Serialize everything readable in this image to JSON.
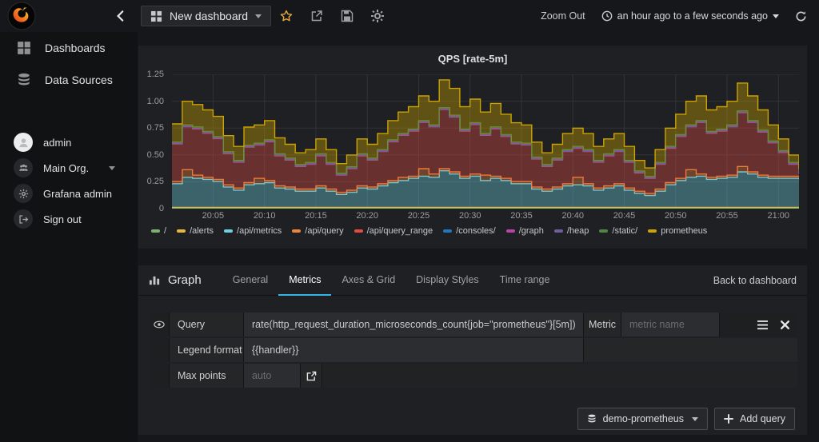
{
  "header": {
    "dashboard_title": "New dashboard",
    "zoom_out_label": "Zoom Out",
    "time_range_label": "an hour ago to a few seconds ago"
  },
  "sidebar": {
    "nav_items": [
      {
        "label": "Dashboards"
      },
      {
        "label": "Data Sources"
      }
    ],
    "account_items": [
      {
        "label": "admin"
      },
      {
        "label": "Main Org."
      },
      {
        "label": "Grafana admin"
      },
      {
        "label": "Sign out"
      }
    ]
  },
  "panel": {
    "title": "QPS [rate-5m]"
  },
  "chart_data": {
    "type": "area",
    "stacked": true,
    "steps": true,
    "title": "QPS [rate-5m]",
    "points": 62,
    "x_start": "20:01",
    "x_end": "21:02",
    "ylim": [
      0,
      1.25
    ],
    "y_ticks": [
      "0",
      "0.25",
      "0.50",
      "0.75",
      "1.00",
      "1.25"
    ],
    "x_ticks": [
      "20:05",
      "20:10",
      "20:15",
      "20:20",
      "20:25",
      "20:30",
      "20:35",
      "20:40",
      "20:45",
      "20:50",
      "20:55",
      "21:00"
    ],
    "tick_first_index": 4,
    "tick_step": 5,
    "grid": true,
    "legend_position": "bottom",
    "fill_opacity": 0.38,
    "series": [
      {
        "name": "/",
        "color": "#7EB26D",
        "value_constant": 0.004
      },
      {
        "name": "/alerts",
        "color": "#EAB839",
        "value_constant": 0.008
      },
      {
        "name": "/api/metrics",
        "color": "#6ED0E0",
        "values": [
          0.22,
          0.28,
          0.27,
          0.26,
          0.24,
          0.19,
          0.16,
          0.21,
          0.22,
          0.23,
          0.18,
          0.17,
          0.15,
          0.15,
          0.18,
          0.15,
          0.12,
          0.14,
          0.18,
          0.17,
          0.2,
          0.23,
          0.25,
          0.27,
          0.29,
          0.28,
          0.34,
          0.31,
          0.27,
          0.29,
          0.25,
          0.27,
          0.25,
          0.22,
          0.22,
          0.17,
          0.15,
          0.17,
          0.2,
          0.21,
          0.2,
          0.16,
          0.18,
          0.2,
          0.16,
          0.13,
          0.11,
          0.15,
          0.21,
          0.25,
          0.28,
          0.29,
          0.26,
          0.27,
          0.28,
          0.33,
          0.31,
          0.28,
          0.27,
          0.27,
          0.27,
          0.26
        ]
      },
      {
        "name": "/api/query",
        "color": "#EF843C",
        "values": [
          0.02,
          0.07,
          0.03,
          0.02,
          0.02,
          0.02,
          0.02,
          0.02,
          0.05,
          0.02,
          0.02,
          0.02,
          0.02,
          0.02,
          0.02,
          0.02,
          0.02,
          0.02,
          0.02,
          0.02,
          0.02,
          0.02,
          0.03,
          0.02,
          0.07,
          0.03,
          0.02,
          0.02,
          0.02,
          0.02,
          0.05,
          0.02,
          0.02,
          0.02,
          0.02,
          0.02,
          0.02,
          0.02,
          0.02,
          0.07,
          0.02,
          0.02,
          0.02,
          0.02,
          0.02,
          0.02,
          0.02,
          0.02,
          0.02,
          0.02,
          0.07,
          0.02,
          0.02,
          0.02,
          0.02,
          0.05,
          0.02,
          0.02,
          0.02,
          0.02,
          0.02,
          0.02
        ]
      },
      {
        "name": "/api/query_range",
        "color": "#E24D42",
        "values": [
          0.35,
          0.4,
          0.43,
          0.41,
          0.38,
          0.29,
          0.24,
          0.33,
          0.31,
          0.36,
          0.28,
          0.25,
          0.21,
          0.23,
          0.28,
          0.23,
          0.16,
          0.2,
          0.28,
          0.25,
          0.3,
          0.36,
          0.39,
          0.42,
          0.43,
          0.44,
          0.55,
          0.51,
          0.42,
          0.46,
          0.37,
          0.44,
          0.39,
          0.35,
          0.34,
          0.26,
          0.21,
          0.25,
          0.3,
          0.27,
          0.3,
          0.24,
          0.28,
          0.3,
          0.24,
          0.17,
          0.14,
          0.23,
          0.32,
          0.39,
          0.4,
          0.48,
          0.41,
          0.42,
          0.45,
          0.5,
          0.46,
          0.4,
          0.31,
          0.22,
          0.11,
          0.03
        ]
      },
      {
        "name": "/consoles/",
        "color": "#1F78C1",
        "value_constant": 0.004
      },
      {
        "name": "/graph",
        "color": "#BA43A9",
        "value_constant": 0.003
      },
      {
        "name": "/heap",
        "color": "#705DA0",
        "value_constant": 0.004
      },
      {
        "name": "/static/",
        "color": "#508642",
        "value_constant": 0.006
      },
      {
        "name": "prometheus",
        "color": "#CCA300",
        "values": [
          0.17,
          0.22,
          0.21,
          0.2,
          0.19,
          0.15,
          0.13,
          0.17,
          0.17,
          0.18,
          0.15,
          0.13,
          0.11,
          0.12,
          0.14,
          0.12,
          0.09,
          0.11,
          0.14,
          0.13,
          0.15,
          0.18,
          0.2,
          0.21,
          0.23,
          0.22,
          0.26,
          0.25,
          0.21,
          0.22,
          0.2,
          0.22,
          0.19,
          0.18,
          0.17,
          0.14,
          0.11,
          0.13,
          0.15,
          0.17,
          0.15,
          0.13,
          0.14,
          0.15,
          0.13,
          0.1,
          0.08,
          0.12,
          0.17,
          0.19,
          0.22,
          0.23,
          0.2,
          0.21,
          0.22,
          0.26,
          0.23,
          0.19,
          0.15,
          0.11,
          0.07,
          0.03
        ]
      }
    ]
  },
  "editor": {
    "panel_type_label": "Graph",
    "tabs": [
      {
        "label": "General"
      },
      {
        "label": "Metrics",
        "active": true
      },
      {
        "label": "Axes & Grid"
      },
      {
        "label": "Display Styles"
      },
      {
        "label": "Time range"
      }
    ],
    "back_to_dashboard_label": "Back to dashboard",
    "rows": {
      "query": {
        "label": "Query",
        "value": "rate(http_request_duration_microseconds_count{job=\"prometheus\"}[5m])",
        "metric_label": "Metric",
        "metric_placeholder": "metric name"
      },
      "legend": {
        "label": "Legend format",
        "value": "{{handler}}"
      },
      "max_points": {
        "label": "Max points",
        "placeholder": "auto"
      }
    },
    "datasource_button_label": "demo-prometheus",
    "add_query_button_label": "Add query"
  },
  "colors": {
    "accent_blue": "#33b5e5",
    "star_yellow": "#e7a83c"
  }
}
